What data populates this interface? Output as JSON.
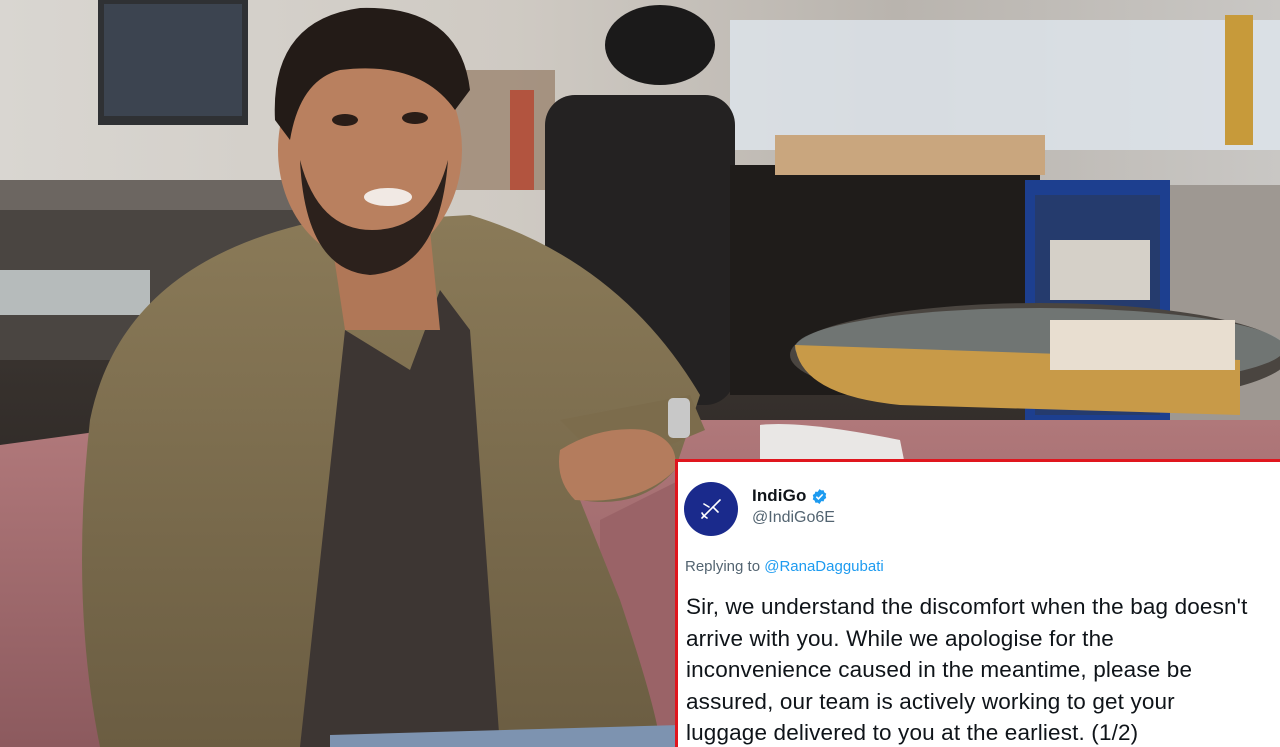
{
  "tweet": {
    "display_name": "IndiGo",
    "handle": "@IndiGo6E",
    "replying_prefix": "Replying to",
    "replying_to": "@RanaDaggubati",
    "text": "Sir, we understand the discomfort when the bag doesn't arrive with you. While we apologise for the inconvenience caused in the meantime, please be assured, our team is actively working to get your luggage delivered to you at the earliest. (1/2)",
    "avatar_icon": "indigo-plane-logo",
    "verified_icon": "verified-badge-icon"
  },
  "colors": {
    "card_border": "#e0161e",
    "avatar_bg": "#1a2a8c",
    "link": "#1d9bf0",
    "secondary_text": "#536471"
  }
}
